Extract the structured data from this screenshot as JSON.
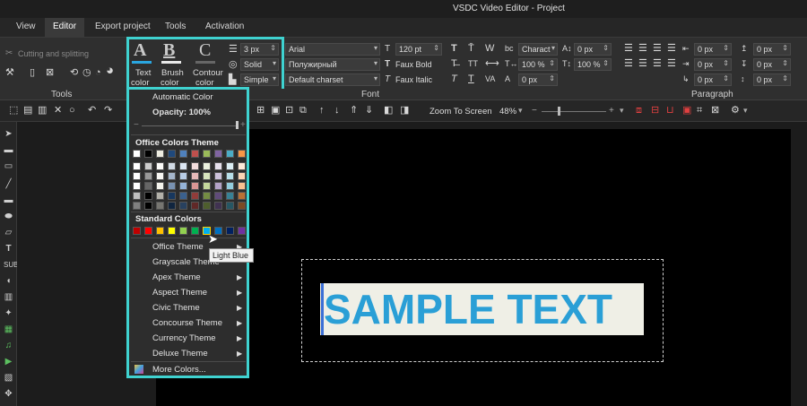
{
  "window": {
    "title": "VSDC Video Editor - Project"
  },
  "menu": {
    "tabs": [
      "View",
      "Editor",
      "Export project",
      "Tools",
      "Activation"
    ],
    "active": "Editor"
  },
  "ribbon": {
    "cutting_label": "Cutting and splitting",
    "tools_group": "Tools",
    "font_group": "Font",
    "paragraph_group": "Paragraph",
    "text_color": {
      "line1": "Text",
      "line2": "color"
    },
    "brush_color": {
      "line1": "Brush",
      "line2": "color"
    },
    "contour_color": {
      "line1": "Contour",
      "line2": "color"
    },
    "stroke_width": "3 px",
    "stroke_style": "Solid",
    "stroke_join": "Simple",
    "font_name": "Arial",
    "font_style": "Полужирный",
    "charset": "Default charset",
    "font_size": "120 pt",
    "faux_bold": "Faux Bold",
    "faux_italic": "Faux Italic",
    "char_spacing_label": "Charact",
    "px0_a": "0 px",
    "scale_h": "100 %",
    "scale_v": "100 %",
    "px0_b": "0 px",
    "px0_c": "0 px",
    "para_px": [
      "0 px",
      "0 px",
      "0 px",
      "0 px",
      "0 px",
      "0 px"
    ]
  },
  "toolbar2": {
    "zoom_label": "Zoom To Screen",
    "zoom_value": "48%"
  },
  "color_menu": {
    "automatic": "Automatic Color",
    "opacity": "Opacity: 100%",
    "office_theme": "Office Colors Theme",
    "standard_colors": "Standard Colors",
    "themes": [
      "Office Theme",
      "Grayscale Theme",
      "Apex Theme",
      "Aspect Theme",
      "Civic Theme",
      "Concourse Theme",
      "Currency Theme",
      "Deluxe Theme"
    ],
    "more_colors": "More Colors...",
    "tooltip": "Light Blue",
    "office_palette": [
      "#ffffff",
      "#000000",
      "#eeece1",
      "#1f497d",
      "#4f81bd",
      "#c0504d",
      "#9bbb59",
      "#8064a2",
      "#4bacc6",
      "#f79646"
    ],
    "standard_palette": [
      "#c00000",
      "#ff0000",
      "#ffc000",
      "#ffff00",
      "#92d050",
      "#00b050",
      "#00b0f0",
      "#0070c0",
      "#002060",
      "#7030a0"
    ]
  },
  "canvas": {
    "sample_text": "SAMPLE TEXT"
  }
}
